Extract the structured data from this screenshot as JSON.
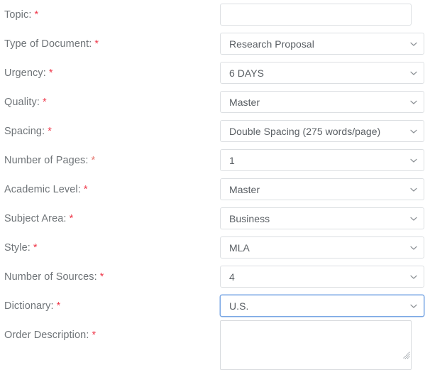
{
  "form": {
    "required_marker": "*",
    "colors": {
      "required": "#ef3b4d",
      "label": "#6f7478",
      "border": "#dcdfe2",
      "focus_border": "#7aa7e4",
      "value_text": "#5a5f64"
    },
    "fields": [
      {
        "name": "topic",
        "label": "Topic:",
        "required": true,
        "control": "text",
        "value": "",
        "placeholder": ""
      },
      {
        "name": "type-of-document",
        "label": "Type of Document:",
        "required": true,
        "control": "select",
        "value": "Research Proposal"
      },
      {
        "name": "urgency",
        "label": "Urgency:",
        "required": true,
        "control": "select",
        "value": "6 DAYS"
      },
      {
        "name": "quality",
        "label": "Quality:",
        "required": true,
        "control": "select",
        "value": "Master"
      },
      {
        "name": "spacing",
        "label": "Spacing:",
        "required": true,
        "control": "select",
        "value": "Double Spacing (275 words/page)"
      },
      {
        "name": "number-of-pages",
        "label": "Number of Pages:",
        "required": true,
        "control": "select",
        "value": "1"
      },
      {
        "name": "academic-level",
        "label": "Academic Level:",
        "required": true,
        "control": "select",
        "value": "Master"
      },
      {
        "name": "subject-area",
        "label": "Subject Area:",
        "required": true,
        "control": "select",
        "value": "Business"
      },
      {
        "name": "style",
        "label": "Style:",
        "required": true,
        "control": "select",
        "value": "MLA"
      },
      {
        "name": "number-of-sources",
        "label": "Number of Sources:",
        "required": true,
        "control": "select",
        "value": "4"
      },
      {
        "name": "dictionary",
        "label": "Dictionary:",
        "required": true,
        "control": "select",
        "value": "U.S.",
        "focused": true
      },
      {
        "name": "order-description",
        "label": "Order Description:",
        "required": true,
        "control": "textarea",
        "value": "",
        "placeholder": ""
      }
    ]
  },
  "icons": {
    "chevron": "chevron-down-icon",
    "resize": "resize-grip-icon"
  }
}
